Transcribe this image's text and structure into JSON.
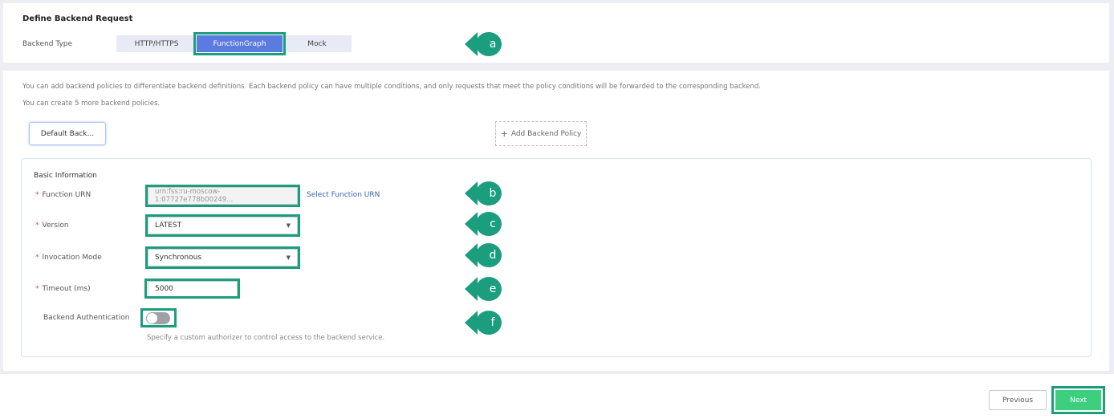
{
  "section_title": "Define Backend Request",
  "backend_type": {
    "label": "Backend Type",
    "options": [
      "HTTP/HTTPS",
      "FunctionGraph",
      "Mock"
    ],
    "selected": "FunctionGraph"
  },
  "info_text": "You can add backend policies to differentiate backend definitions. Each backend policy can have multiple conditions, and only requests that meet the policy conditions will be forwarded to the corresponding backend.",
  "policy_count_text": "You can create 5 more backend policies.",
  "default_backend_tab": "Default Back...",
  "add_policy": "Add Backend Policy",
  "basic_info": "Basic Information",
  "fields": {
    "urn": {
      "label": "Function URN",
      "value": "urn:fss:ru-moscow-1:07727e778b00249...",
      "link": "Select Function URN"
    },
    "version": {
      "label": "Version",
      "value": "LATEST"
    },
    "invocation": {
      "label": "Invocation Mode",
      "value": "Synchronous"
    },
    "timeout": {
      "label": "Timeout (ms)",
      "value": "5000"
    },
    "auth": {
      "label": "Backend Authentication",
      "enabled": false,
      "hint": "Specify a custom authorizer to control access to the backend service."
    }
  },
  "callouts": [
    "a",
    "b",
    "c",
    "d",
    "e",
    "f"
  ],
  "buttons": {
    "previous": "Previous",
    "next": "Next"
  },
  "colors": {
    "accent": "#1a9e7e",
    "selected": "#5b7be0",
    "next": "#3ecf7e",
    "link": "#3c63b8"
  }
}
